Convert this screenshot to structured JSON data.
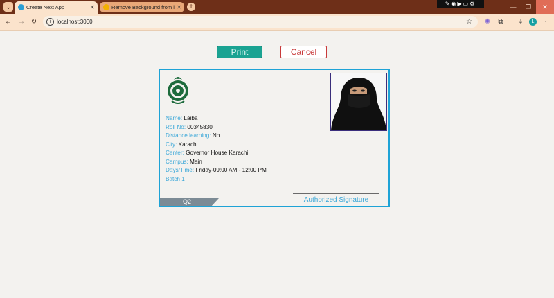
{
  "browser": {
    "tabs": [
      {
        "title": "Create Next App",
        "active": true,
        "favicon_color": "#2a9fd6"
      },
      {
        "title": "Remove Background from imag",
        "active": false,
        "favicon_color": "#f2b000"
      }
    ],
    "address": "localhost:3000",
    "profile_initial": "L",
    "icons": {
      "tab_search": "chevron-down-icon",
      "new_tab": "plus-icon",
      "back": "back-arrow-icon",
      "forward": "forward-arrow-icon",
      "reload": "reload-icon",
      "bookmark": "star-icon",
      "extensions": "puzzle-icon",
      "downloads": "download-icon",
      "menu": "kebab-menu-icon"
    }
  },
  "actions": {
    "print_label": "Print",
    "cancel_label": "Cancel"
  },
  "card": {
    "fields": [
      {
        "label": "Name:",
        "value": "Laiba"
      },
      {
        "label": "Roll No:",
        "value": "00345830"
      },
      {
        "label": "Distance learning:",
        "value": "No"
      },
      {
        "label": "City:",
        "value": "Karachi"
      },
      {
        "label": "Center:",
        "value": "Governor House Karachi"
      },
      {
        "label": "Campus:",
        "value": "Main"
      },
      {
        "label": "Days/Time:",
        "value": "Friday-09:00 AM - 12:00 PM"
      }
    ],
    "batch": "Batch 1",
    "quarter_tag": "Q2",
    "signature_label": "Authorized Signature"
  },
  "colors": {
    "accent_blue": "#1ea3d6",
    "print_button": "#1aa392",
    "cancel_border": "#c83a3a",
    "tab_bar": "#6e2f18"
  }
}
